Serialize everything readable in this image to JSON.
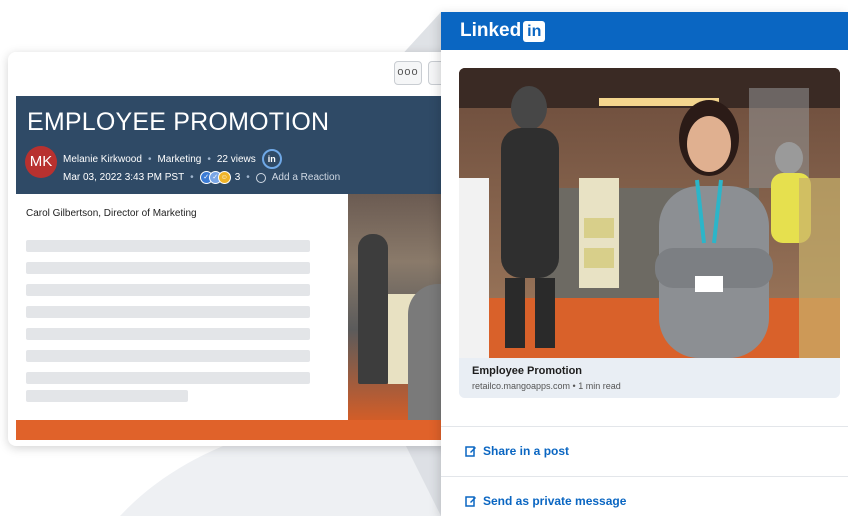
{
  "post": {
    "more_label": "ooo",
    "title": "EMPLOYEE PROMOTION",
    "avatar_initials": "MK",
    "author": "Melanie Kirkwood",
    "category": "Marketing",
    "views": "22 views",
    "linkedin_badge": "in",
    "date": "Mar 03, 2022 3:43 PM PST",
    "reaction_count": "3",
    "add_reaction": "Add a Reaction",
    "body_first_line": "Carol Gilbertson, Director of Marketing"
  },
  "linkedin": {
    "logo_text": "Linked",
    "logo_in": "in",
    "preview_title": "Employee Promotion",
    "preview_source": "retailco.mangoapps.com • 1 min read",
    "share_post_label": "Share in a post",
    "private_message_label": "Send as private message"
  },
  "colors": {
    "linkedin_blue": "#0a66c2",
    "post_header": "#2f4a66",
    "accent_orange": "#e0622a",
    "avatar_red": "#b8312f"
  }
}
